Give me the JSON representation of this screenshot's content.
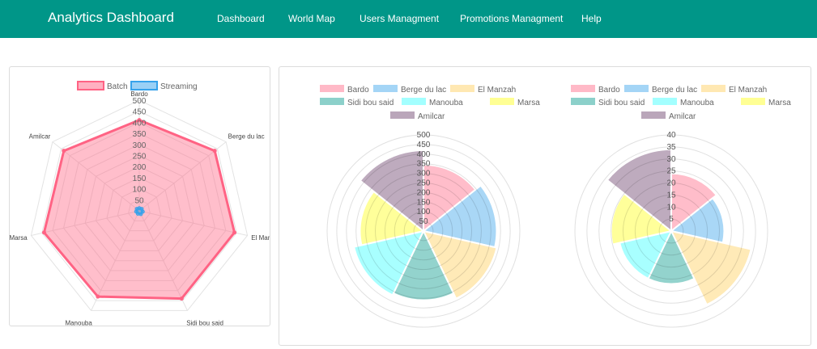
{
  "navbar": {
    "brand": "Analytics Dashboard",
    "links": [
      "Dashboard",
      "World Map",
      "Users Managment",
      "Promotions Managment",
      "Help"
    ],
    "color": "#009688"
  },
  "chart_data": [
    {
      "type": "radar",
      "labels": [
        "Bardo",
        "Berge du lac",
        "El Manzah",
        "Sidi bou said",
        "Manouba",
        "Marsa",
        "Amilcar"
      ],
      "series": [
        {
          "name": "Batch",
          "values": [
            410,
            435,
            440,
            440,
            430,
            440,
            435
          ],
          "color": "#ff6384"
        },
        {
          "name": "Streaming",
          "values": [
            12,
            14,
            16,
            16,
            14,
            14,
            14
          ],
          "color": "#36a2eb"
        }
      ],
      "ticks": [
        "50",
        "100",
        "150",
        "200",
        "250",
        "300",
        "350",
        "400",
        "450",
        "500"
      ],
      "rlim": [
        0,
        500
      ],
      "legend": "top"
    },
    {
      "type": "polarArea",
      "labels": [
        "Bardo",
        "Berge du lac",
        "El Manzah",
        "Sidi bou said",
        "Manouba",
        "Marsa",
        "Amilcar"
      ],
      "values": [
        345,
        380,
        390,
        360,
        370,
        330,
        420
      ],
      "ticks": [
        "50",
        "100",
        "150",
        "200",
        "250",
        "300",
        "350",
        "400",
        "450",
        "500"
      ],
      "rlim": [
        0,
        500
      ],
      "legend": "top"
    },
    {
      "type": "polarArea",
      "labels": [
        "Bardo",
        "Berge du lac",
        "El Manzah",
        "Sidi bou said",
        "Manouba",
        "Marsa",
        "Amilcar"
      ],
      "values": [
        24,
        22,
        34,
        22,
        22,
        25,
        34
      ],
      "ticks": [
        "5",
        "10",
        "15",
        "20",
        "25",
        "30",
        "35",
        "40"
      ],
      "rlim": [
        0,
        40
      ],
      "legend": "top"
    }
  ],
  "colors": {
    "Bardo": "#ffb1c1",
    "Berge du lac": "#9ad0f5",
    "El Manzah": "#ffe6aa",
    "Sidi bou said": "#80cbc4",
    "Manouba": "#99ffff",
    "Marsa": "#ffff88",
    "Amilcar": "#b39cb3"
  }
}
